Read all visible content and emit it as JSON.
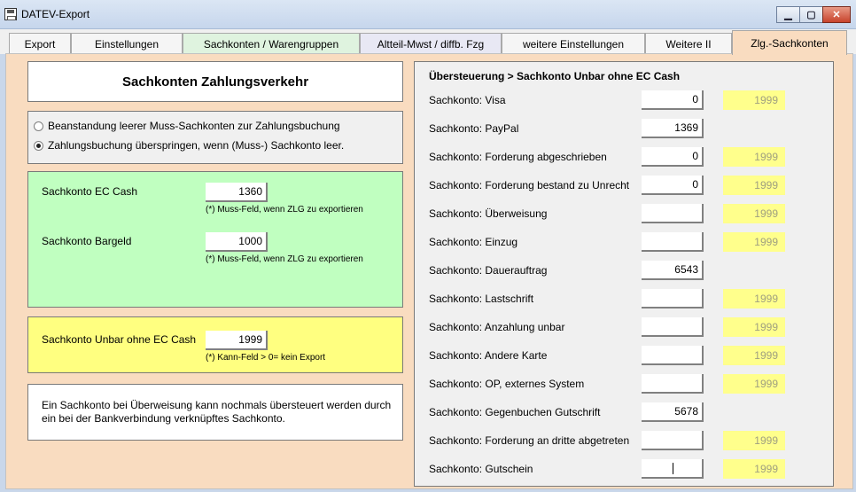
{
  "window": {
    "title": "DATEV-Export"
  },
  "tabs": [
    {
      "label": "Export"
    },
    {
      "label": "Einstellungen"
    },
    {
      "label": "Sachkonten / Warengruppen"
    },
    {
      "label": "Altteil-Mwst / diffb. Fzg"
    },
    {
      "label": "weitere Einstellungen"
    },
    {
      "label": "Weitere II"
    },
    {
      "label": "Zlg.-Sachkonten"
    }
  ],
  "active_tab": "Zlg.-Sachkonten",
  "left": {
    "heading": "Sachkonten Zahlungsverkehr",
    "radio_options": [
      {
        "label": "Beanstandung leerer Muss-Sachkonten zur Zahlungsbuchung",
        "checked": false
      },
      {
        "label": "Zahlungsbuchung überspringen, wenn (Muss-) Sachkonto leer.",
        "checked": true
      }
    ],
    "ec_cash": {
      "label": "Sachkonto EC Cash",
      "value": "1360",
      "hint": "(*) Muss-Feld, wenn ZLG zu exportieren"
    },
    "bargeld": {
      "label": "Sachkonto Bargeld",
      "value": "1000",
      "hint": "(*) Muss-Feld, wenn ZLG zu exportieren"
    },
    "unbar": {
      "label": "Sachkonto Unbar ohne EC Cash",
      "value": "1999",
      "hint": "(*) Kann-Feld > 0= kein Export"
    },
    "info_text": "Ein Sachkonto bei Überweisung kann nochmals übersteuert werden durch ein bei der Bankverbindung verknüpftes Sachkonto."
  },
  "right": {
    "heading": "Übersteuerung > Sachkonto Unbar ohne EC Cash",
    "rows": [
      {
        "label": "Sachkonto: Visa",
        "value": "0",
        "default": "1999"
      },
      {
        "label": "Sachkonto: PayPal",
        "value": "1369",
        "default": ""
      },
      {
        "label": "Sachkonto: Forderung abgeschrieben",
        "value": "0",
        "default": "1999"
      },
      {
        "label": "Sachkonto: Forderung bestand zu Unrecht",
        "value": "0",
        "default": "1999"
      },
      {
        "label": "Sachkonto: Überweisung",
        "value": "",
        "default": "1999"
      },
      {
        "label": "Sachkonto: Einzug",
        "value": "",
        "default": "1999"
      },
      {
        "label": "Sachkonto: Dauerauftrag",
        "value": "6543",
        "default": ""
      },
      {
        "label": "Sachkonto: Lastschrift",
        "value": "",
        "default": "1999"
      },
      {
        "label": "Sachkonto: Anzahlung unbar",
        "value": "",
        "default": "1999"
      },
      {
        "label": "Sachkonto: Andere Karte",
        "value": "",
        "default": "1999"
      },
      {
        "label": "Sachkonto: OP, externes System",
        "value": "",
        "default": "1999"
      },
      {
        "label": "Sachkonto: Gegenbuchen Gutschrift",
        "value": "5678",
        "default": ""
      },
      {
        "label": "Sachkonto: Forderung an dritte abgetreten",
        "value": "",
        "default": "1999"
      },
      {
        "label": "Sachkonto: Gutschein",
        "value": "",
        "default": "1999"
      }
    ]
  },
  "colors": {
    "active_tab_bg": "#f9dcc0",
    "green_panel": "#c0ffc0",
    "yellow_panel": "#ffff80",
    "default_field": "#ffff8c"
  }
}
